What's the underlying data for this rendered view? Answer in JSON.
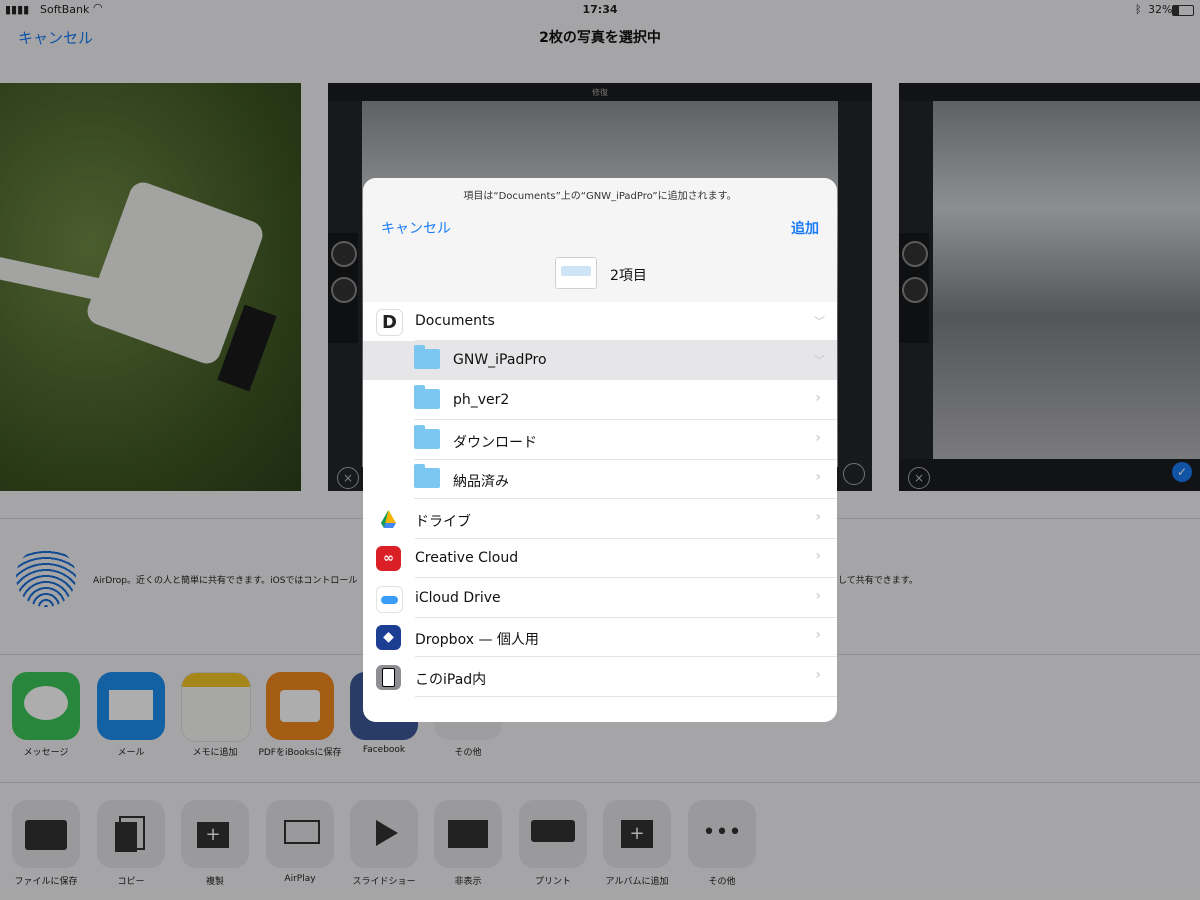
{
  "status": {
    "carrier": "SoftBank",
    "time": "17:34",
    "battery": "32%"
  },
  "nav": {
    "cancel": "キャンセル",
    "title": "2枚の写真を選択中"
  },
  "photos": {
    "app_title": "修復"
  },
  "airdrop": {
    "text": "AirDrop。近くの人と簡単に共有できます。iOSではコントロール",
    "tail": "して共有できます。"
  },
  "apps": [
    {
      "label": "メッセージ",
      "color": "#3dc85a"
    },
    {
      "label": "メール",
      "color": "#1d8ff0"
    },
    {
      "label": "メモに追加",
      "color": "#f2f2f2"
    },
    {
      "label": "PDFをiBooksに保存",
      "color": "#f28a1e"
    },
    {
      "label": "Facebook",
      "color": "#3b5998"
    },
    {
      "label": "その他",
      "color": "#e9e9ec"
    }
  ],
  "actions": [
    {
      "label": "ファイルに保存"
    },
    {
      "label": "コピー"
    },
    {
      "label": "複製"
    },
    {
      "label": "AirPlay"
    },
    {
      "label": "スライドショー"
    },
    {
      "label": "非表示"
    },
    {
      "label": "プリント"
    },
    {
      "label": "アルバムに追加"
    },
    {
      "label": "その他"
    }
  ],
  "modal": {
    "notice": "項目は“Documents”上の“GNW_iPadPro”に追加されます。",
    "cancel": "キャンセル",
    "add": "追加",
    "item_count": "2項目",
    "locations": [
      {
        "label": "Documents",
        "icon": "documents-app-icon",
        "expanded": true
      },
      {
        "label": "GNW_iPadPro",
        "icon": "folder-icon",
        "selected": true,
        "expanded": true
      },
      {
        "label": "ph_ver2",
        "icon": "folder-icon"
      },
      {
        "label": "ダウンロード",
        "icon": "folder-icon"
      },
      {
        "label": "納品済み",
        "icon": "folder-icon"
      },
      {
        "label": "ドライブ",
        "icon": "google-drive-icon"
      },
      {
        "label": "Creative Cloud",
        "icon": "creative-cloud-icon"
      },
      {
        "label": "iCloud Drive",
        "icon": "icloud-icon"
      },
      {
        "label": "Dropbox — 個人用",
        "icon": "dropbox-icon"
      },
      {
        "label": "このiPad内",
        "icon": "ipad-icon"
      }
    ]
  }
}
